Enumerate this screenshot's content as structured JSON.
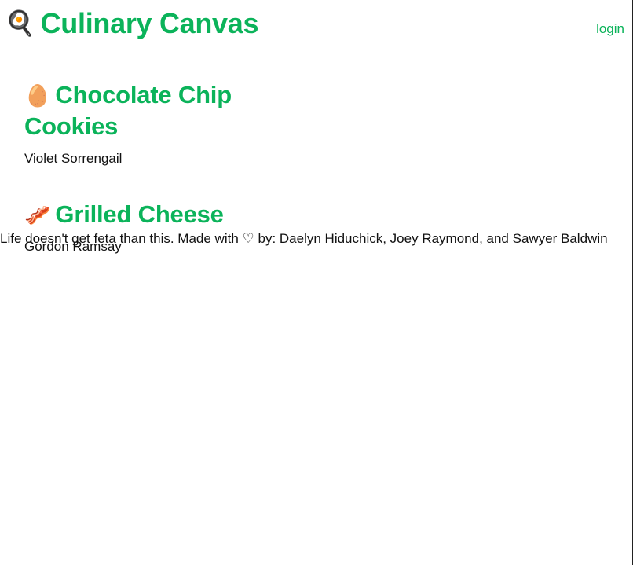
{
  "header": {
    "logo_emoji": "🍳",
    "logo_icon_name": "frying-pan-egg-icon",
    "title": "Culinary Canvas",
    "login_label": "login"
  },
  "recipes": [
    {
      "emoji": "🥚",
      "icon_name": "egg-icon",
      "title": "Chocolate Chip Cookies",
      "author": "Violet Sorrengail"
    },
    {
      "emoji": "🥓",
      "icon_name": "bacon-icon",
      "title": "Grilled Cheese",
      "author": "Gordon Ramsay"
    }
  ],
  "footer": {
    "text_before_heart": "Life doesn't get feta than this. Made with",
    "heart": "♡",
    "text_after_heart": "by: Daelyn Hiduchick, Joey Raymond, and Sawyer Baldwin"
  },
  "colors": {
    "accent": "#0bb35a",
    "header_border": "#9bbcb4",
    "text": "#111111"
  }
}
